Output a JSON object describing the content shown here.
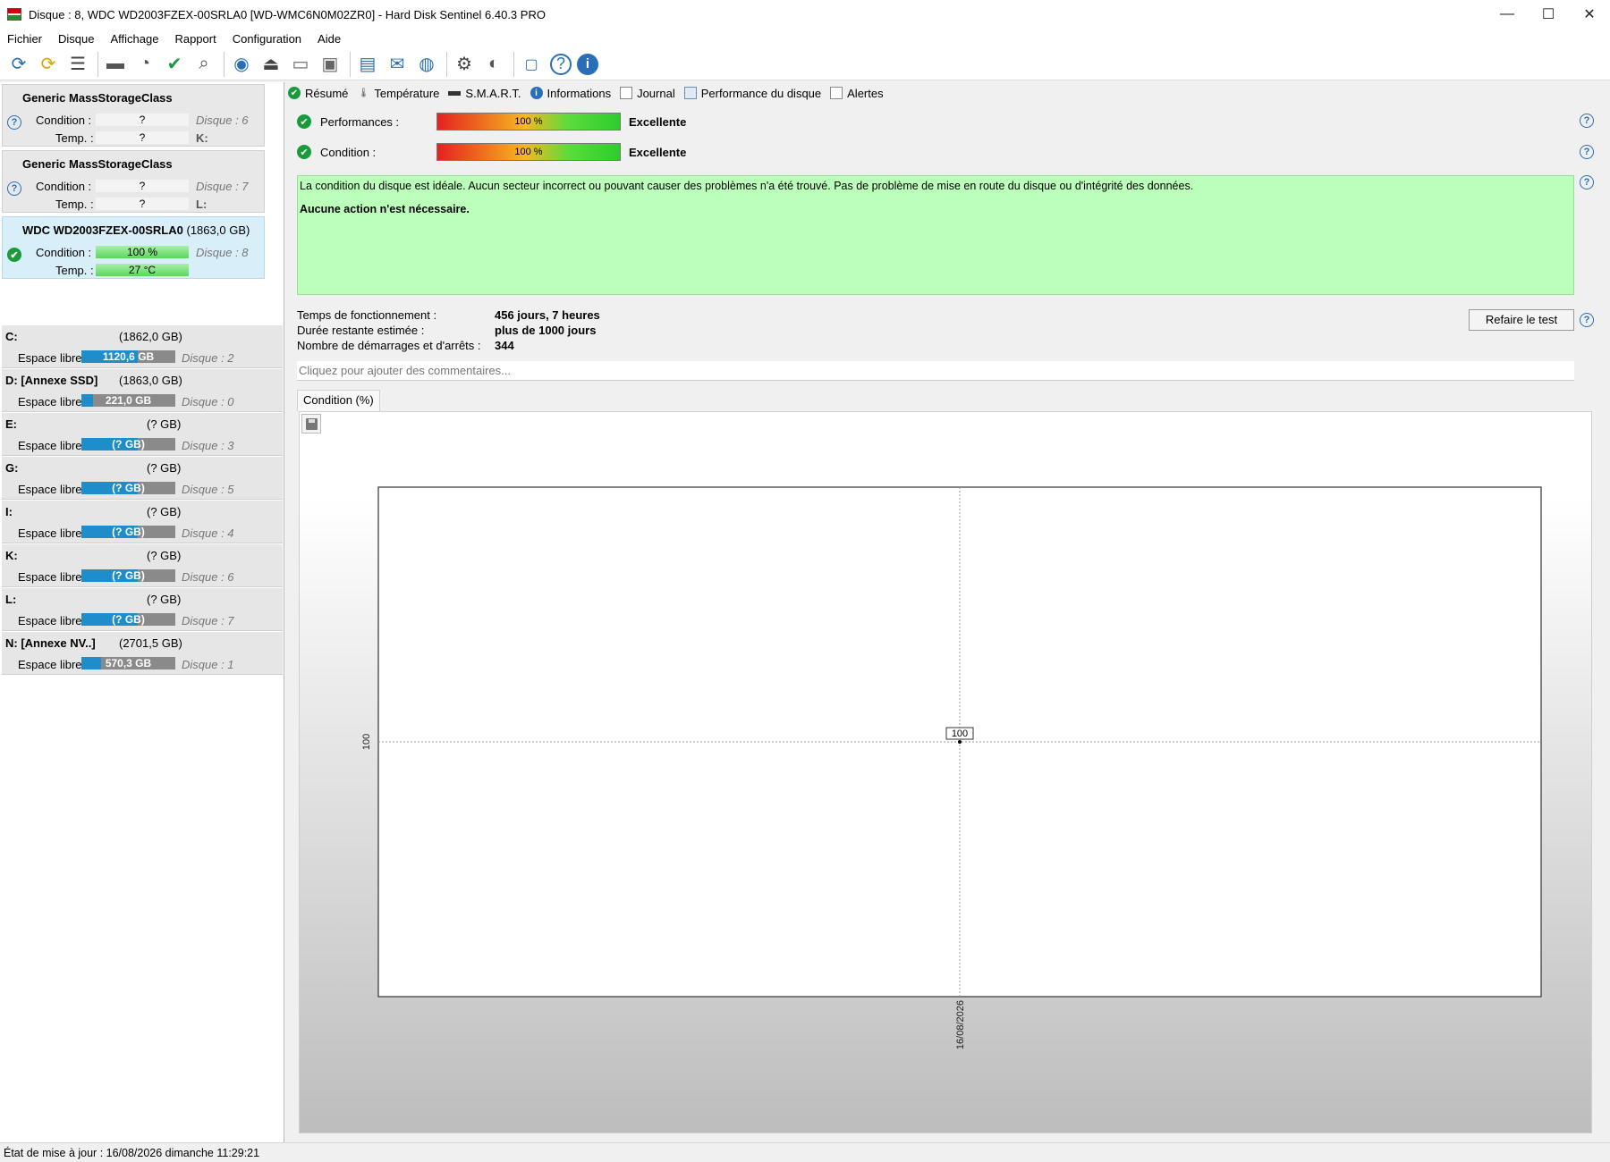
{
  "window": {
    "title": "Disque : 8, WDC WD2003FZEX-00SRLA0 [WD-WMC6N0M02ZR0]  -  Hard Disk Sentinel 6.40.3 PRO",
    "minimize": "—",
    "maximize": "☐",
    "close": "✕"
  },
  "menu": [
    "Fichier",
    "Disque",
    "Affichage",
    "Rapport",
    "Configuration",
    "Aide"
  ],
  "toolbar": {
    "icons": [
      "refresh-icon",
      "refresh-warning-icon",
      "disk-list-icon",
      "disk-icon",
      "disk-clock-icon",
      "disk-check-icon",
      "disk-search-icon",
      "globe-disk-icon",
      "eject-icon",
      "drive-icon",
      "drive-bay-icon",
      "report-icon",
      "email-icon",
      "network-icon",
      "settings-icon",
      "sound-icon",
      "camera-icon",
      "help-icon",
      "info-icon"
    ]
  },
  "disks": [
    {
      "name": "Generic MassStorageClass",
      "size": "",
      "status": "?",
      "condition_label": "Condition :",
      "condition_value": "?",
      "disk_num": "Disque : 6",
      "temp_label": "Temp. :",
      "temp_value": "?",
      "letter": "K:"
    },
    {
      "name": "Generic MassStorageClass",
      "size": "",
      "status": "?",
      "condition_label": "Condition :",
      "condition_value": "?",
      "disk_num": "Disque : 7",
      "temp_label": "Temp. :",
      "temp_value": "?",
      "letter": "L:"
    },
    {
      "name": "WDC WD2003FZEX-00SRLA0",
      "size": "(1863,0 GB)",
      "status": "✔",
      "condition_label": "Condition :",
      "condition_value": "100 %",
      "disk_num": "Disque : 8",
      "temp_label": "Temp. :",
      "temp_value": "27 °C",
      "letter": ""
    }
  ],
  "partitions": [
    {
      "name": "C:",
      "size": "(1862,0 GB)",
      "label": "Espace libre",
      "free": "1120,6 GB",
      "free_fraction": 0.6,
      "disk": "Disque : 2"
    },
    {
      "name": "D: [Annexe SSD]",
      "size": "(1863,0 GB)",
      "label": "Espace libre",
      "free": "221,0 GB",
      "free_fraction": 0.12,
      "disk": "Disque : 0"
    },
    {
      "name": "E:",
      "size": "(? GB)",
      "label": "Espace libre",
      "free": "(? GB)",
      "free_fraction": 0.6,
      "disk": "Disque : 3"
    },
    {
      "name": "G:",
      "size": "(? GB)",
      "label": "Espace libre",
      "free": "(? GB)",
      "free_fraction": 0.6,
      "disk": "Disque : 5"
    },
    {
      "name": "I:",
      "size": "(? GB)",
      "label": "Espace libre",
      "free": "(? GB)",
      "free_fraction": 0.6,
      "disk": "Disque : 4"
    },
    {
      "name": "K:",
      "size": "(? GB)",
      "label": "Espace libre",
      "free": "(? GB)",
      "free_fraction": 0.6,
      "disk": "Disque : 6"
    },
    {
      "name": "L:",
      "size": "(? GB)",
      "label": "Espace libre",
      "free": "(? GB)",
      "free_fraction": 0.6,
      "disk": "Disque : 7"
    },
    {
      "name": "N: [Annexe NV..]",
      "size": "(2701,5 GB)",
      "label": "Espace libre",
      "free": "570,3 GB",
      "free_fraction": 0.21,
      "disk": "Disque : 1"
    }
  ],
  "tabs": [
    {
      "label": "Résumé",
      "icon": "check-icon"
    },
    {
      "label": "Température",
      "icon": "thermometer-icon"
    },
    {
      "label": "S.M.A.R.T.",
      "icon": "disk-icon"
    },
    {
      "label": "Informations",
      "icon": "info-icon"
    },
    {
      "label": "Journal",
      "icon": "document-icon"
    },
    {
      "label": "Performance du disque",
      "icon": "chart-icon"
    },
    {
      "label": "Alertes",
      "icon": "alerts-icon"
    }
  ],
  "summary": {
    "performance_label": "Performances :",
    "performance_value": "100 %",
    "performance_verdict": "Excellente",
    "condition_label": "Condition :",
    "condition_value": "100 %",
    "condition_verdict": "Excellente",
    "message": "La condition du disque est idéale. Aucun secteur incorrect ou pouvant causer des problèmes n'a été trouvé. Pas de problème de mise en route du disque ou d'intégrité des données.",
    "action": "Aucune action n'est nécessaire.",
    "uptime_label": "Temps de fonctionnement :",
    "uptime_value": "456 jours, 7 heures",
    "remaining_label": "Durée restante estimée :",
    "remaining_value": "plus de 1000 jours",
    "startstop_label": "Nombre de démarrages et d'arrêts :",
    "startstop_value": "344",
    "retest_button": "Refaire le test",
    "comment_placeholder": "Cliquez pour ajouter des commentaires..."
  },
  "chart_tab_label": "Condition (%)",
  "chart_data": {
    "type": "line",
    "title": "",
    "x": [
      "16/08/2026"
    ],
    "y_ticks": [
      "100"
    ],
    "series": [
      {
        "values": [
          100
        ]
      }
    ],
    "data_labels": [
      "100"
    ],
    "grid": true
  },
  "statusbar": {
    "text": "État de mise à jour : 16/08/2026 dimanche 11:29:21"
  }
}
